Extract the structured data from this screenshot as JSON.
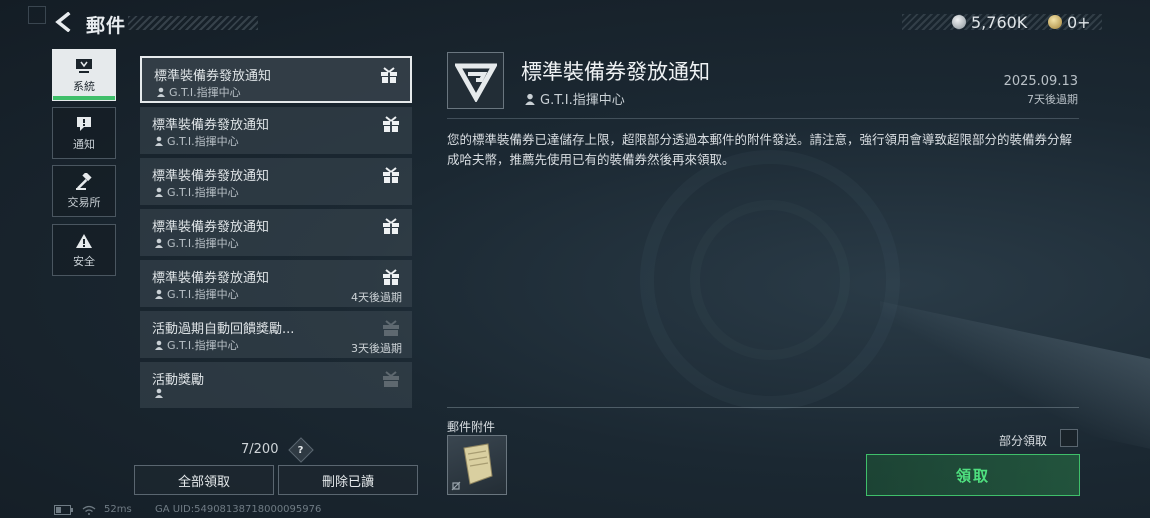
{
  "header": {
    "title": "郵件",
    "currency_silver": "5,760K",
    "currency_gold": "0+"
  },
  "sidebar": {
    "items": [
      {
        "label": "系統",
        "icon": "monitor-icon",
        "active": true
      },
      {
        "label": "通知",
        "icon": "exclamation-icon",
        "active": false
      },
      {
        "label": "交易所",
        "icon": "hammer-icon",
        "active": false
      },
      {
        "label": "安全",
        "icon": "warning-icon",
        "active": false
      }
    ]
  },
  "mail_list": {
    "items": [
      {
        "title": "標準裝備券發放通知",
        "sender": "G.T.I.指揮中心",
        "expire": "",
        "selected": true
      },
      {
        "title": "標準裝備券發放通知",
        "sender": "G.T.I.指揮中心",
        "expire": ""
      },
      {
        "title": "標準裝備券發放通知",
        "sender": "G.T.I.指揮中心",
        "expire": ""
      },
      {
        "title": "標準裝備券發放通知",
        "sender": "G.T.I.指揮中心",
        "expire": ""
      },
      {
        "title": "標準裝備券發放通知",
        "sender": "G.T.I.指揮中心",
        "expire": "4天後過期"
      },
      {
        "title": "活動過期自動回饋獎勵...",
        "sender": "G.T.I.指揮中心",
        "expire": "3天後過期"
      },
      {
        "title": "活動獎勵",
        "sender": "",
        "expire": ""
      }
    ],
    "count": "7/200",
    "help": "?",
    "claim_all": "全部領取",
    "delete_read": "刪除已讀"
  },
  "status_bar": {
    "ping": "52ms",
    "uid": "GA UID:54908138718000095976"
  },
  "detail": {
    "title": "標準裝備券發放通知",
    "sender": "G.T.I.指揮中心",
    "date": "2025.09.13",
    "expire": "7天後過期",
    "body": "您的標準裝備券已達儲存上限，超限部分透過本郵件的附件發送。請注意，強行領用會導致超限部分的裝備券分解成哈夫幣，推薦先使用已有的裝備券然後再來領取。",
    "attachment_label": "郵件附件",
    "partial_claim": "部分領取",
    "claim": "領取"
  },
  "colors": {
    "accent_green": "#3fbf6a",
    "active_tab_bg": "#e6eaec"
  }
}
